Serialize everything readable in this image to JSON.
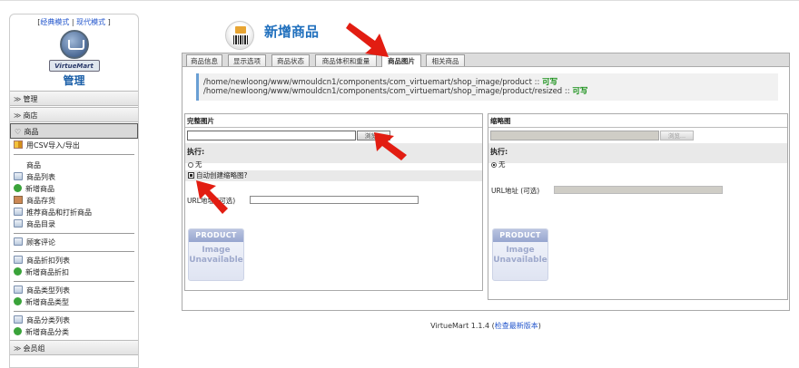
{
  "sidebar": {
    "mode_prefix": "[",
    "mode_classic": "经典模式",
    "mode_sep": " | ",
    "mode_modern": "现代模式",
    "mode_suffix": " ]",
    "logo_text": "VirtueMart",
    "admin_title": "管理",
    "sections": [
      {
        "label": "管理"
      },
      {
        "label": "商店"
      },
      {
        "label": "商品",
        "active": true
      }
    ],
    "csv_item": "用CSV导入/导出",
    "product_group_title": "商品",
    "product_items": [
      "商品列表",
      "新增商品",
      "商品存货",
      "推荐商品和打折商品",
      "商品目录"
    ],
    "review_item": "顾客评论",
    "discount_items": [
      "商品折扣列表",
      "新增商品折扣"
    ],
    "type_items": [
      "商品类型列表",
      "新增商品类型"
    ],
    "category_items": [
      "商品分类列表",
      "新增商品分类"
    ],
    "member_section": "会员组"
  },
  "header": {
    "title": "新增商品",
    "icon": "product-barcode-icon"
  },
  "tabs": [
    {
      "label": "商品信息"
    },
    {
      "label": "显示选项"
    },
    {
      "label": "商品状态"
    },
    {
      "label": "商品体积和重量"
    },
    {
      "label": "商品图片",
      "active": true
    },
    {
      "label": "相关商品"
    }
  ],
  "paths": {
    "line1": "/home/newloong/www/wmouldcn1/components/com_virtuemart/shop_image/product :: ",
    "line1_status": "可写",
    "line2": "/home/newloong/www/wmouldcn1/components/com_virtuemart/shop_image/product/resized :: ",
    "line2_status": "可写"
  },
  "full_image": {
    "header": "完整图片",
    "browse": "浏览...",
    "exec_label": "执行:",
    "radio_none": "无",
    "check_auto_thumb": "自动创建缩略图?",
    "url_label": "URL地址 (可选)",
    "url_value": "",
    "placeholder_top": "PRODUCT",
    "placeholder_l1": "Image",
    "placeholder_l2": "Unavailable"
  },
  "thumb_image": {
    "header": "缩略图",
    "browse": "浏览...",
    "exec_label": "执行:",
    "radio_none": "无",
    "url_label": "URL地址 (可选)",
    "url_value": "",
    "placeholder_top": "PRODUCT",
    "placeholder_l1": "Image",
    "placeholder_l2": "Unavailable"
  },
  "footer": {
    "version": "VirtueMart 1.1.4 (",
    "check_link": "检查最新版本",
    "close": ")"
  },
  "colors": {
    "accent_blue": "#1f6fbd",
    "ok_green": "#189018",
    "arrow_red": "#e21d12"
  }
}
